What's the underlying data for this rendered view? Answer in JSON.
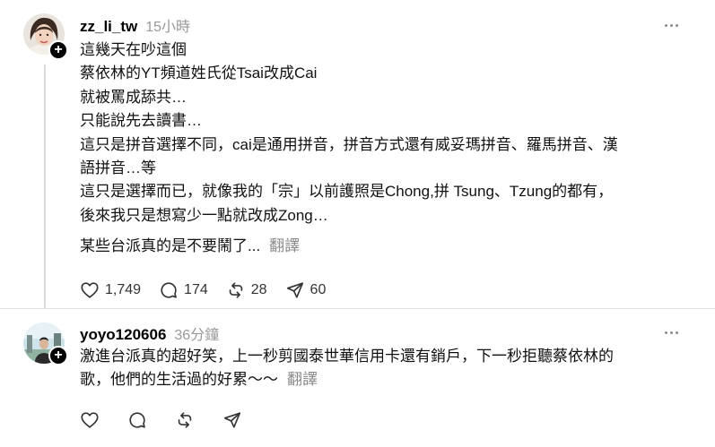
{
  "posts": [
    {
      "username": "zz_li_tw",
      "timestamp": "15小時",
      "lines": [
        "這幾天在吵這個",
        "蔡依林的YT頻道姓氏從Tsai改成Cai",
        "就被罵成舔共…",
        "只能說先去讀書…",
        "這只是拼音選擇不同，cai是通用拼音，拼音方式還有威妥瑪拼音、羅馬拼音、漢",
        "語拼音…等",
        "這只是選擇而已，就像我的「宗」以前護照是Chong,拼 Tsung、Tzung的都有，",
        "後來我只是想寫少一點就改成Zong…"
      ],
      "last_line": "某些台派真的是不要鬧了...",
      "translate_label": "翻譯",
      "stats": {
        "likes": "1,749",
        "replies": "174",
        "reposts": "28",
        "shares": "60"
      },
      "icons": [
        "heart-icon",
        "comment-icon",
        "repost-icon",
        "share-icon",
        "more-icon"
      ]
    },
    {
      "username": "yoyo120606",
      "timestamp": "36分鐘",
      "lines": [
        "激進台派真的超好笑，上一秒剪國泰世華信用卡還有銷戶，下一秒拒聽蔡依林的"
      ],
      "last_line": "歌，他們的生活過的好累～～",
      "translate_label": "翻譯",
      "icons": [
        "heart-icon",
        "comment-icon",
        "repost-icon",
        "share-icon",
        "more-icon"
      ]
    }
  ],
  "colors": {
    "text": "#111111",
    "secondary": "#999999",
    "divider": "#e3e3e3",
    "badge": "#000000"
  }
}
